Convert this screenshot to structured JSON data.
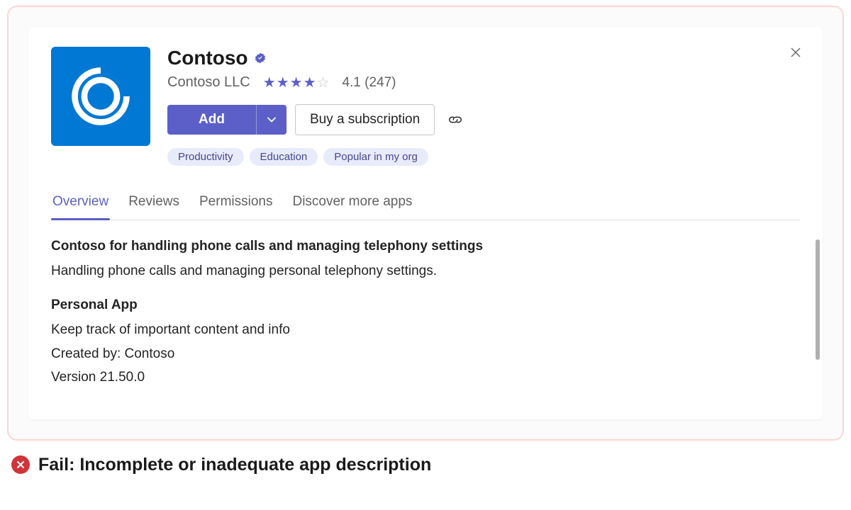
{
  "app": {
    "name": "Contoso",
    "publisher": "Contoso LLC",
    "rating": "4.1",
    "rating_count": "(247)",
    "stars_filled": 4,
    "stars_total": 5
  },
  "actions": {
    "add": "Add",
    "buy": "Buy a subscription"
  },
  "tags": [
    "Productivity",
    "Education",
    "Popular in my org"
  ],
  "tabs": [
    {
      "label": "Overview",
      "active": true
    },
    {
      "label": "Reviews",
      "active": false
    },
    {
      "label": "Permissions",
      "active": false
    },
    {
      "label": "Discover more apps",
      "active": false
    }
  ],
  "overview": {
    "headline": "Contoso for handling phone calls and managing telephony settings",
    "summary": "Handling phone calls and managing personal telephony settings.",
    "section_title": "Personal App",
    "section_line1": "Keep track of important content and info",
    "created_by": "Created by: Contoso",
    "version": "Version 21.50.0"
  },
  "caption": "Fail: Incomplete or inadequate app description"
}
